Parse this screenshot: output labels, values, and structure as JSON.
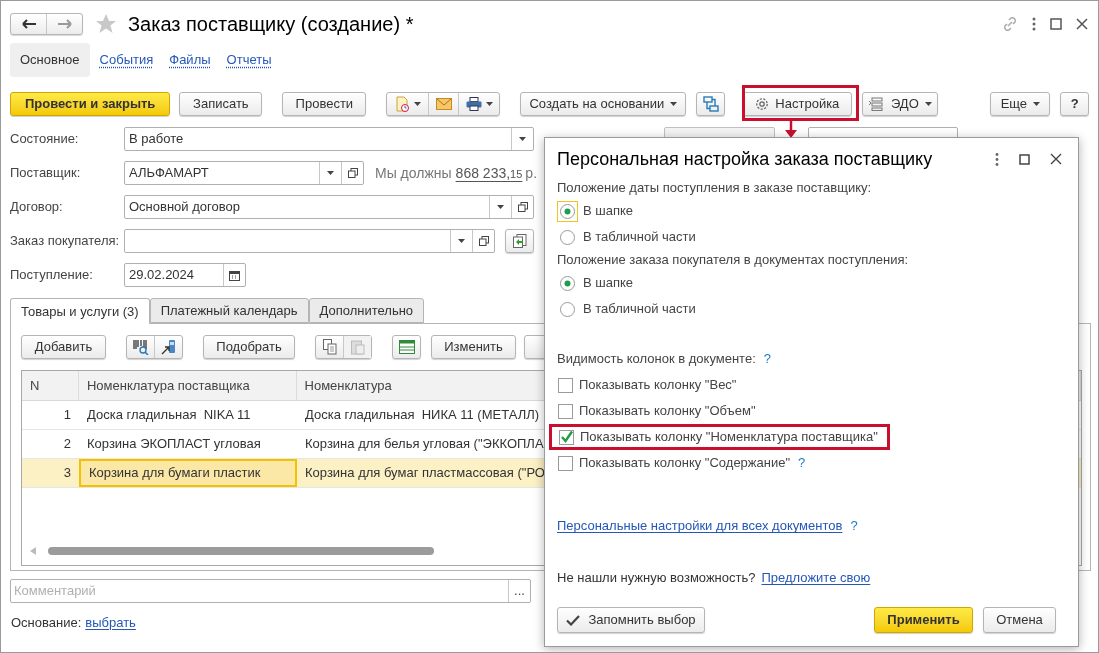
{
  "window": {
    "title": "Заказ поставщику (создание) *"
  },
  "sections": [
    {
      "label": "Основное",
      "selected": true
    },
    {
      "label": "События",
      "selected": false
    },
    {
      "label": "Файлы",
      "selected": false
    },
    {
      "label": "Отчеты",
      "selected": false
    }
  ],
  "toolbar": {
    "post_close": "Провести и закрыть",
    "save": "Записать",
    "post": "Провести",
    "create_based": "Создать на основании",
    "settings": {
      "label": "Настройка",
      "highlighted": true
    },
    "edo": "ЭДО",
    "more": "Еще",
    "help": "?"
  },
  "fields": [
    {
      "label": "Состояние:",
      "value": "В работе",
      "kind": "select"
    },
    {
      "label": "Поставщик:",
      "value": "АЛЬФАМАРТ",
      "kind": "select_open",
      "debt": {
        "prefix": "Мы должны",
        "amount": "868 233,",
        "kopecks": "15",
        "currency": "р."
      }
    },
    {
      "label": "Договор:",
      "value": "Основной договор",
      "kind": "select_open"
    },
    {
      "label": "Заказ покупателя:",
      "kind": "select_open_fill"
    },
    {
      "label": "Поступление:",
      "value": "29.02.2024",
      "kind": "date"
    }
  ],
  "tabs": [
    {
      "label": "Товары и услуги (3)",
      "selected": true
    },
    {
      "label": "Платежный календарь",
      "selected": false
    },
    {
      "label": "Дополнительно",
      "selected": false
    }
  ],
  "table_toolbar": {
    "add": "Добавить",
    "pick": "Подобрать",
    "change": "Изменить"
  },
  "table": {
    "columns": [
      "N",
      "Номенклатура поставщика",
      "Номенклатура"
    ],
    "rows": [
      {
        "cells": [
          "1",
          "Доска гладильная  NIKA 11",
          "Доска гладильная  НИКА 11 (МЕТАЛЛ)"
        ],
        "selected": false
      },
      {
        "cells": [
          "2",
          "Корзина ЭКОПЛАСТ угловая",
          "Корзина для белья угловая (\"ЭККОПЛА"
        ],
        "selected": false
      },
      {
        "cells": [
          "3",
          "Корзина для бумаги пластик",
          "Корзина для бумаг пластмассовая (\"РО"
        ],
        "selected": true
      }
    ]
  },
  "comment": {
    "placeholder": "Комментарий",
    "button": "..."
  },
  "basis": {
    "label": "Основание:",
    "link": "выбрать"
  },
  "dialog": {
    "title": "Персональная настройка заказа поставщику",
    "groups": [
      {
        "label": "Положение даты поступления в заказе поставщику:",
        "options": [
          {
            "label": "В шапке",
            "selected": true,
            "focused": true
          },
          {
            "label": "В табличной части",
            "selected": false,
            "focused": false
          }
        ]
      },
      {
        "label": "Положение заказа покупателя в документах поступления:",
        "options": [
          {
            "label": "В шапке",
            "selected": true,
            "focused": false
          },
          {
            "label": "В табличной части",
            "selected": false,
            "focused": false
          }
        ]
      }
    ],
    "visibility": {
      "label": "Видимость колонок в документе:",
      "help": "?"
    },
    "checkboxes": [
      {
        "label": "Показывать колонку \"Вес\"",
        "checked": false,
        "highlighted": false
      },
      {
        "label": "Показывать колонку \"Объем\"",
        "checked": false,
        "highlighted": false
      },
      {
        "label": "Показывать колонку \"Номенклатура поставщика\"",
        "checked": true,
        "highlighted": true
      },
      {
        "label": "Показывать колонку \"Содержание\"",
        "checked": false,
        "highlighted": false,
        "help": "?"
      }
    ],
    "all_docs_link": "Персональные настройки для всех документов",
    "all_docs_help": "?",
    "suggest_text": "Не нашли нужную возможность?",
    "suggest_link": "Предложите свою",
    "remember_button": "Запомнить выбор",
    "apply_button": "Применить",
    "cancel_button": "Отмена"
  }
}
